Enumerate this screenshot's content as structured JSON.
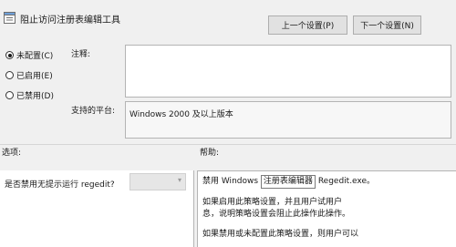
{
  "window": {
    "title": "阻止访问注册表编辑工具"
  },
  "nav": {
    "prev_label": "上一个设置(P)",
    "next_label": "下一个设置(N)"
  },
  "state": {
    "options": [
      {
        "label": "未配置(C)",
        "selected": true
      },
      {
        "label": "已启用(E)",
        "selected": false
      },
      {
        "label": "已禁用(D)",
        "selected": false
      }
    ]
  },
  "comment": {
    "label": "注释:",
    "value": ""
  },
  "platform": {
    "label": "支持的平台:",
    "value": "Windows 2000 及以上版本"
  },
  "options_panel": {
    "label": "选项:",
    "question": "是否禁用无提示运行 regedit?",
    "combo_value": ""
  },
  "help": {
    "label": "帮助:",
    "line1_prefix": "禁用 Windows",
    "line1_highlight": "注册表编辑器",
    "line1_suffix": "Regedit.exe。",
    "line2": "如果启用此策略设置，并且用户试用户",
    "line3": "息，说明策略设置会阻止此操作此操作。",
    "line4": "如果禁用或未配置此策略设置，则用户可以"
  }
}
